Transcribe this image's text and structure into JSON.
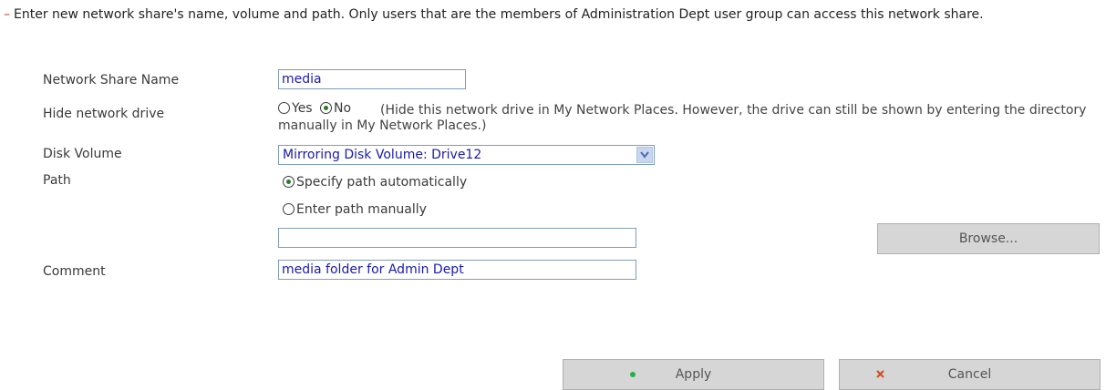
{
  "intro": {
    "dash": "–",
    "text": "Enter new network share's name, volume and path. Only users that are the members of Administration Dept user group can access this network share."
  },
  "form": {
    "share_name": {
      "label": "Network Share Name",
      "value": "media"
    },
    "hide_drive": {
      "label": "Hide network drive",
      "options": [
        {
          "label": "Yes",
          "checked": false
        },
        {
          "label": "No",
          "checked": true
        }
      ],
      "note": "(Hide this network drive in My Network Places. However, the drive can still be shown by entering the directory manually in My Network Places.)"
    },
    "disk_volume": {
      "label": "Disk Volume",
      "selected": "Mirroring Disk Volume: Drive12"
    },
    "path": {
      "label": "Path",
      "options": [
        {
          "label": "Specify path automatically",
          "checked": true
        },
        {
          "label": "Enter path manually",
          "checked": false
        }
      ],
      "manual_value": "",
      "browse_label": "Browse..."
    },
    "comment": {
      "label": "Comment",
      "value": "media folder for Admin Dept"
    }
  },
  "actions": {
    "apply_label": "Apply",
    "cancel_label": "Cancel",
    "apply_icon": "green-dot-icon",
    "cancel_icon": "red-x-icon"
  },
  "colors": {
    "input_text": "#1a1aa8",
    "apply_dot": "#22b14c",
    "cancel_x": "#d04a1a"
  }
}
